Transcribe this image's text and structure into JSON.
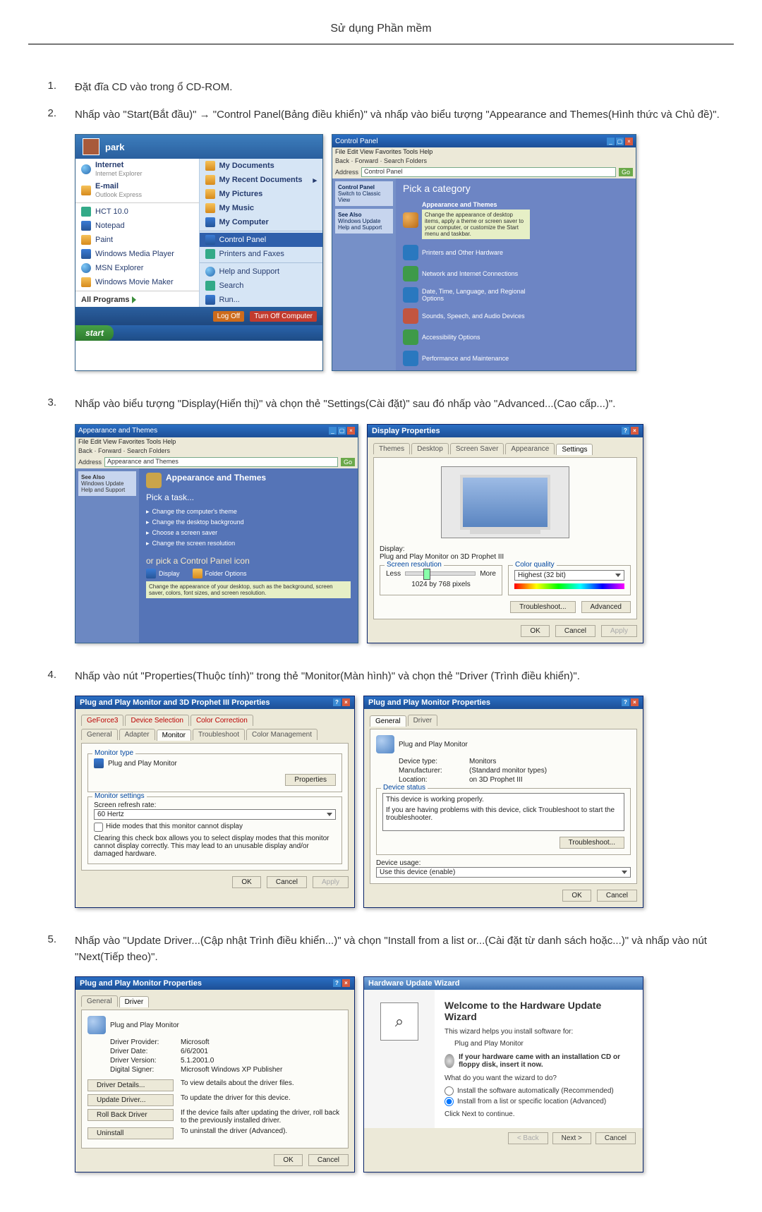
{
  "page": {
    "title": "Sử dụng Phần mềm"
  },
  "steps": {
    "s1": {
      "num": "1.",
      "text": "Đặt đĩa CD vào trong ổ CD-ROM."
    },
    "s2": {
      "num": "2.",
      "text": "Nhấp vào \"Start(Bắt đầu)\" → \"Control Panel(Bảng điều khiển)\" và nhấp vào biểu tượng \"Appearance and Themes(Hình thức và Chủ đề)\"."
    },
    "s3": {
      "num": "3.",
      "text": "Nhấp vào biểu tượng \"Display(Hiển thị)\" và chọn thẻ \"Settings(Cài đặt)\" sau đó nhấp vào \"Advanced...(Cao cấp...)\"."
    },
    "s4": {
      "num": "4.",
      "text": "Nhấp vào nút \"Properties(Thuộc tính)\" trong thẻ \"Monitor(Màn hình)\" và chọn thẻ \"Driver (Trình điều khiển)\"."
    },
    "s5": {
      "num": "5.",
      "text": "Nhấp vào \"Update Driver...(Cập nhật Trình điều khiển...)\" và chọn \"Install from a list or...(Cài đặt từ danh sách hoặc...)\" và nhấp vào nút \"Next(Tiếp theo)\"."
    }
  },
  "startmenu": {
    "user": "park",
    "left": {
      "internet": "Internet",
      "internet_sub": "Internet Explorer",
      "email": "E-mail",
      "email_sub": "Outlook Express",
      "app1": "HCT 10.0",
      "app2": "Notepad",
      "app3": "Paint",
      "app4": "Windows Media Player",
      "app5": "MSN Explorer",
      "app6": "Windows Movie Maker",
      "all": "All Programs"
    },
    "right": {
      "r1": "My Documents",
      "r2": "My Recent Documents",
      "r3": "My Pictures",
      "r4": "My Music",
      "r5": "My Computer",
      "r6": "Control Panel",
      "r7": "Printers and Faxes",
      "r8": "Help and Support",
      "r9": "Search",
      "r10": "Run..."
    },
    "footer": {
      "logoff": "Log Off",
      "shutdown": "Turn Off Computer"
    },
    "start": "start"
  },
  "ctrlpanel": {
    "title": "Control Panel",
    "menu": "File   Edit   View   Favorites   Tools   Help",
    "tool": "Back  ·  Forward  ·  Search   Folders",
    "addr_label": "Address",
    "addr_value": "Control Panel",
    "go": "Go",
    "side1": "Control Panel",
    "side1a": "Switch to Classic View",
    "side2": "See Also",
    "side2a": "Windows Update",
    "side2b": "Help and Support",
    "pick": "Pick a category",
    "c1": "Appearance and Themes",
    "c1tip": "Change the appearance of desktop items, apply a theme or screen saver to your computer, or customize the Start menu and taskbar.",
    "c2": "Printers and Other Hardware",
    "c3": "Network and Internet Connections",
    "c4": "Date, Time, Language, and Regional Options",
    "c5": "Sounds, Speech, and Audio Devices",
    "c6": "Accessibility Options",
    "c7": "Performance and Maintenance"
  },
  "atwin": {
    "title": "Appearance and Themes",
    "pick": "Pick a task...",
    "t1": "Change the computer's theme",
    "t2": "Change the desktop background",
    "t3": "Choose a screen saver",
    "t4": "Change the screen resolution",
    "or": "or pick a Control Panel icon",
    "i1": "Display",
    "i2": "Folder Options",
    "tip": "Change the appearance of your desktop, such as the background, screen saver, colors, font sizes, and screen resolution."
  },
  "dispprop": {
    "title": "Display Properties",
    "tabs": {
      "t1": "Themes",
      "t2": "Desktop",
      "t3": "Screen Saver",
      "t4": "Appearance",
      "t5": "Settings"
    },
    "display_lbl": "Display:",
    "display_val": "Plug and Play Monitor on 3D Prophet III",
    "res_title": "Screen resolution",
    "less": "Less",
    "more": "More",
    "res_val": "1024 by 768 pixels",
    "cq_title": "Color quality",
    "cq_val": "Highest (32 bit)",
    "tshoot": "Troubleshoot...",
    "adv": "Advanced",
    "ok": "OK",
    "cancel": "Cancel",
    "apply": "Apply"
  },
  "monadv": {
    "title": "Plug and Play Monitor and 3D Prophet III Properties",
    "tabs": {
      "a1": "GeForce3",
      "a2": "Device Selection",
      "a3": "Color Correction",
      "b1": "General",
      "b2": "Adapter",
      "b3": "Monitor",
      "b4": "Troubleshoot",
      "b5": "Color Management"
    },
    "mtype": "Monitor type",
    "mtype_val": "Plug and Play Monitor",
    "prop": "Properties",
    "mset": "Monitor settings",
    "rr_lbl": "Screen refresh rate:",
    "rr_val": "60 Hertz",
    "chk": "Hide modes that this monitor cannot display",
    "note": "Clearing this check box allows you to select display modes that this monitor cannot display correctly. This may lead to an unusable display and/or damaged hardware."
  },
  "monprop": {
    "title": "Plug and Play Monitor Properties",
    "tabs": {
      "g": "General",
      "d": "Driver"
    },
    "name": "Plug and Play Monitor",
    "k1": "Device type:",
    "v1": "Monitors",
    "k2": "Manufacturer:",
    "v2": "(Standard monitor types)",
    "k3": "Location:",
    "v3": "on 3D Prophet III",
    "status_title": "Device status",
    "status1": "This device is working properly.",
    "status2": "If you are having problems with this device, click Troubleshoot to start the troubleshooter.",
    "tshoot": "Troubleshoot...",
    "du_label": "Device usage:",
    "du_val": "Use this device (enable)"
  },
  "drvtab": {
    "title": "Plug and Play Monitor Properties",
    "mon": "Plug and Play Monitor",
    "k1": "Driver Provider:",
    "v1": "Microsoft",
    "k2": "Driver Date:",
    "v2": "6/6/2001",
    "k3": "Driver Version:",
    "v3": "5.1.2001.0",
    "k4": "Digital Signer:",
    "v4": "Microsoft Windows XP Publisher",
    "b1": "Driver Details...",
    "d1": "To view details about the driver files.",
    "b2": "Update Driver...",
    "d2": "To update the driver for this device.",
    "b3": "Roll Back Driver",
    "d3": "If the device fails after updating the driver, roll back to the previously installed driver.",
    "b4": "Uninstall",
    "d4": "To uninstall the driver (Advanced)."
  },
  "wizard": {
    "title": "Hardware Update Wizard",
    "welcome": "Welcome to the Hardware Update Wizard",
    "l1": "This wizard helps you install software for:",
    "l2": "Plug and Play Monitor",
    "cd": "If your hardware came with an installation CD or floppy disk, insert it now.",
    "q": "What do you want the wizard to do?",
    "r1": "Install the software automatically (Recommended)",
    "r2": "Install from a list or specific location (Advanced)",
    "cont": "Click Next to continue.",
    "back": "< Back",
    "next": "Next >",
    "cancel": "Cancel"
  }
}
